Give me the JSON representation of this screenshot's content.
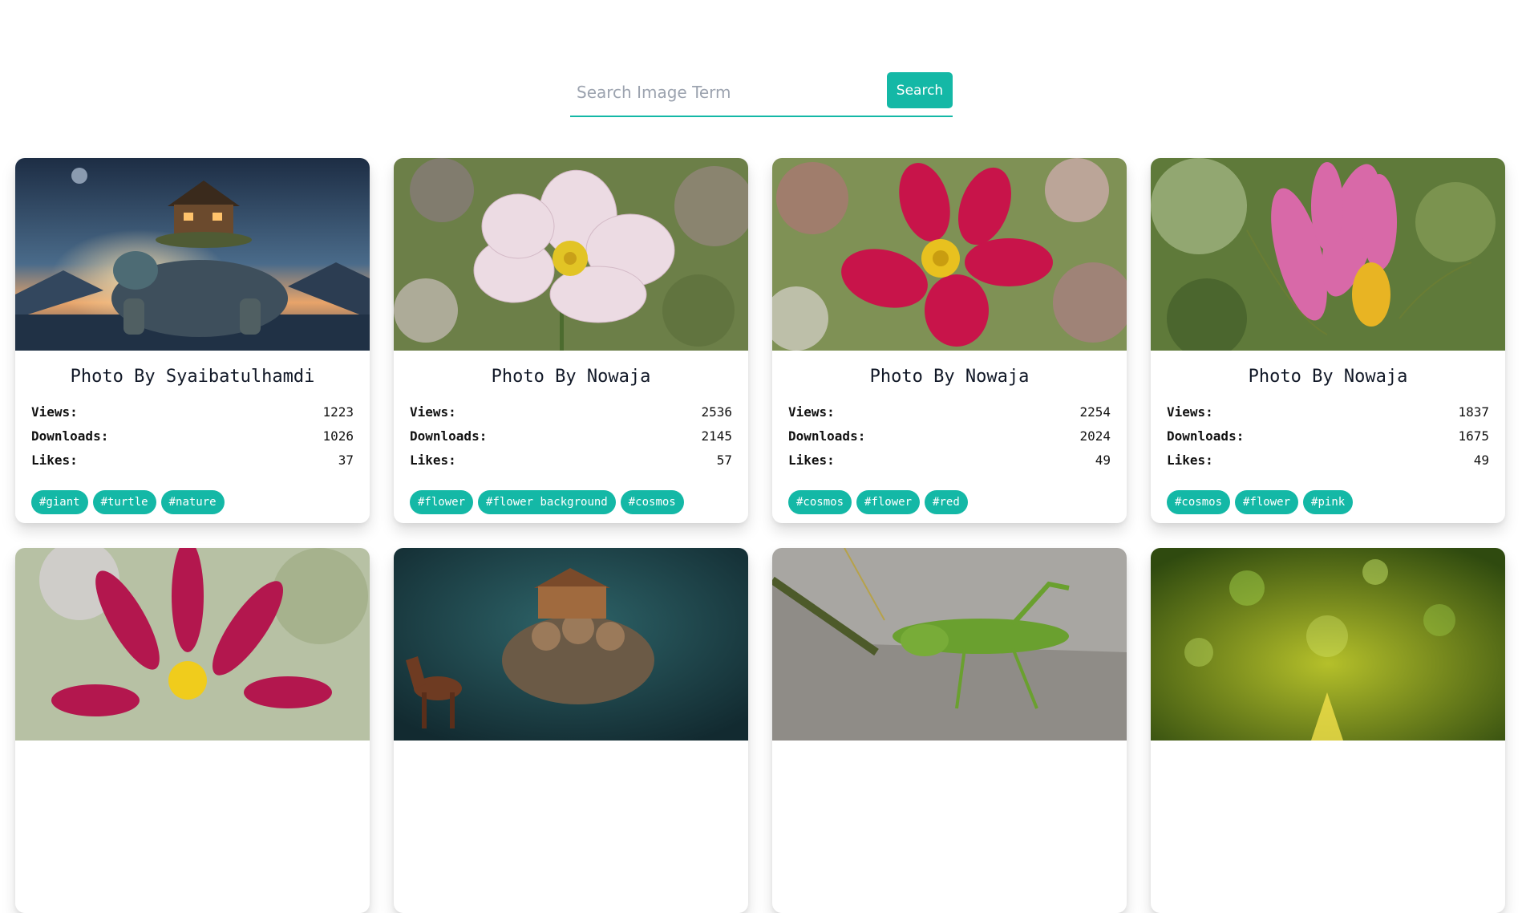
{
  "search": {
    "placeholder": "Search Image Term",
    "value": "",
    "button_label": "Search"
  },
  "labels": {
    "views": "Views:",
    "downloads": "Downloads:",
    "likes": "Likes:"
  },
  "cards": [
    {
      "photographer": "Photo By Syaibatulhamdi",
      "views": "1223",
      "downloads": "1026",
      "likes": "37",
      "tags": [
        "#giant",
        "#turtle",
        "#nature"
      ],
      "image": "giant turtle carrying a wooden house at night"
    },
    {
      "photographer": "Photo By Nowaja",
      "views": "2536",
      "downloads": "2145",
      "likes": "57",
      "tags": [
        "#flower",
        "#flower background",
        "#cosmos"
      ],
      "image": "pale pink cosmos flower"
    },
    {
      "photographer": "Photo By Nowaja",
      "views": "2254",
      "downloads": "2024",
      "likes": "49",
      "tags": [
        "#cosmos",
        "#flower",
        "#red"
      ],
      "image": "red cosmos flower"
    },
    {
      "photographer": "Photo By Nowaja",
      "views": "1837",
      "downloads": "1675",
      "likes": "49",
      "tags": [
        "#cosmos",
        "#flower",
        "#pink"
      ],
      "image": "pink cosmos flower bud"
    },
    {
      "image": "magenta cosmos flower"
    },
    {
      "image": "turtle carrying house with horse"
    },
    {
      "image": "green grasshopper on pavement"
    },
    {
      "image": "green bokeh background"
    }
  ],
  "colors": {
    "accent": "#14b8a6",
    "text": "#111827",
    "placeholder": "#9ca3af"
  }
}
